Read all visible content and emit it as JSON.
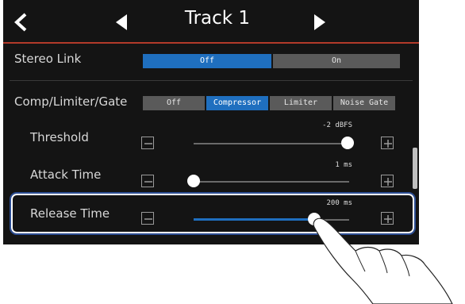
{
  "header": {
    "title": "Track 1",
    "icons": [
      "back-icon",
      "previous-track-icon",
      "next-track-icon"
    ]
  },
  "stereo_link": {
    "label": "Stereo Link",
    "options": [
      "Off",
      "On"
    ],
    "selected": "Off"
  },
  "comp_limiter_gate": {
    "label": "Comp/Limiter/Gate",
    "options": [
      "Off",
      "Compressor",
      "Limiter",
      "Noise Gate"
    ],
    "selected": "Compressor"
  },
  "params": [
    {
      "label": "Threshold",
      "value": "-2 dBFS",
      "level": 0.98
    },
    {
      "label": "Attack Time",
      "value": "1 ms",
      "level": 0.0
    },
    {
      "label": "Release Time",
      "value": "200 ms",
      "level": 0.78
    }
  ],
  "colors": {
    "accent": "#1f6fbf",
    "header_line": "#b33a2a",
    "highlight_frame": "#2c4d93",
    "background": "#141414"
  }
}
